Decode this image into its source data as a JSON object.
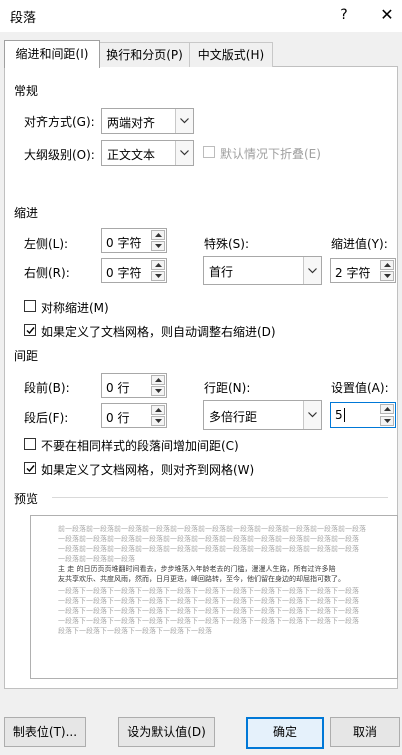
{
  "window": {
    "title": "段落",
    "help": "?",
    "close": "✕"
  },
  "tabs": [
    {
      "label": "缩进和间距(I)",
      "active": true
    },
    {
      "label": "换行和分页(P)",
      "active": false
    },
    {
      "label": "中文版式(H)",
      "active": false
    }
  ],
  "general": {
    "title": "常规",
    "alignment_label": "对齐方式(G):",
    "alignment_value": "两端对齐",
    "outline_label": "大纲级别(O):",
    "outline_value": "正文文本",
    "collapse_label": "默认情况下折叠(E)"
  },
  "indent": {
    "title": "缩进",
    "left_label": "左侧(L):",
    "left_value": "0 字符",
    "right_label": "右侧(R):",
    "right_value": "0 字符",
    "special_label": "特殊(S):",
    "special_value": "首行",
    "by_label": "缩进值(Y):",
    "by_value": "2 字符",
    "mirror_label": "对称缩进(M)",
    "mirror_checked": false,
    "auto_adjust_label": "如果定义了文档网格，则自动调整右缩进(D)",
    "auto_adjust_checked": true
  },
  "spacing": {
    "title": "间距",
    "before_label": "段前(B):",
    "before_value": "0 行",
    "after_label": "段后(F):",
    "after_value": "0 行",
    "line_label": "行距(N):",
    "line_value": "多倍行距",
    "at_label": "设置值(A):",
    "at_value": "5",
    "no_space_label": "不要在相同样式的段落间增加间距(C)",
    "no_space_checked": false,
    "snap_grid_label": "如果定义了文档网格，则对齐到网格(W)",
    "snap_grid_checked": true
  },
  "preview": {
    "title": "预览",
    "prev_lines": [
      "前一段落前一段落前一段落前一段落前一段落前一段落前一段落前一段落前一段落前一段落前一段落",
      "一段落前一段落前一段落前一段落前一段落前一段落前一段落前一段落前一段落前一段落前一段落",
      "一段落前一段落前一段落前一段落前一段落前一段落前一段落前一段落前一段落前一段落前一段落",
      "一段落前一段落前一段落"
    ],
    "sample_lines": [
      "主 走 的日历页页堆翻时间看去，步步堆落入年龄老去的门槛，漫漫人生路，所有过许多陪",
      "友共享欢乐、共度风雨，然而，日月更迭，峰回路转，至今，他们留在身边的却屈指可数了。"
    ],
    "next_lines": [
      "一段落下一段落下一段落下一段落下一段落下一段落下一段落下一段落下一段落下一段落下一段落",
      "一段落下一段落下一段落下一段落下一段落下一段落下一段落下一段落下一段落下一段落下一段落",
      "一段落下一段落下一段落下一段落下一段落下一段落下一段落下一段落下一段落下一段落下一段落",
      "一段落下一段落下一段落下一段落下一段落下一段落下一段落下一段落下一段落下一段落下一段落",
      "段落下一段落下一段落下一段落下一段落下一段落"
    ]
  },
  "buttons": {
    "tabs": "制表位(T)...",
    "set_default": "设为默认值(D)",
    "ok": "确定",
    "cancel": "取消"
  }
}
